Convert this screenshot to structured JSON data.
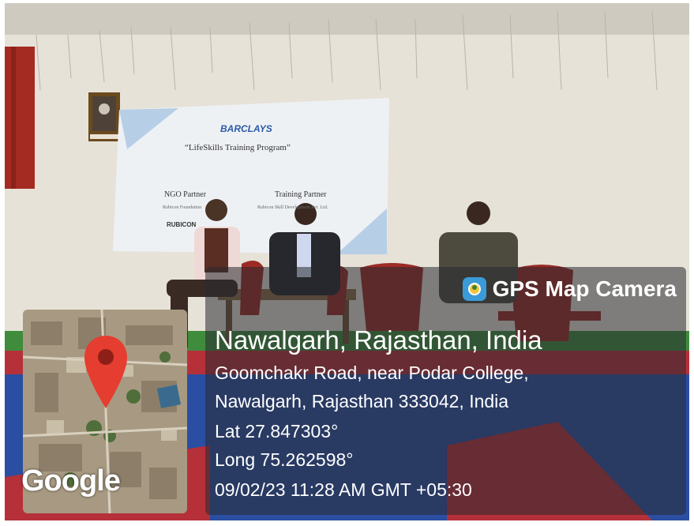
{
  "overlay": {
    "app_name": "GPS Map Camera",
    "app_icon": "gps-camera-icon",
    "location_title": "Nawalgarh, Rajasthan, India",
    "address_line1": "Goomchakr Road, near Podar College,",
    "address_line2": "Nawalgarh, Rajasthan 333042, India",
    "latitude": "Lat 27.847303°",
    "longitude": "Long 75.262598°",
    "datetime": "09/02/23 11:28 AM GMT +05:30",
    "map_logo": "Google"
  },
  "slide": {
    "brand": "BARCLAYS",
    "title": "“LifeSkills Training Program”",
    "ngo_heading": "NGO Partner",
    "training_heading": "Training Partner",
    "ngo_name": "Rubicon Foundation",
    "training_name": "Rubicon Skill Development Pvt. Ltd.",
    "logo_text": "RUBICON"
  },
  "colors": {
    "overlay_bg": "#2a2c30",
    "map_pin": "#e53d2f",
    "stage_blue": "#2b4a9a",
    "stage_red": "#b6303a",
    "chair_red": "#9c2b26"
  }
}
